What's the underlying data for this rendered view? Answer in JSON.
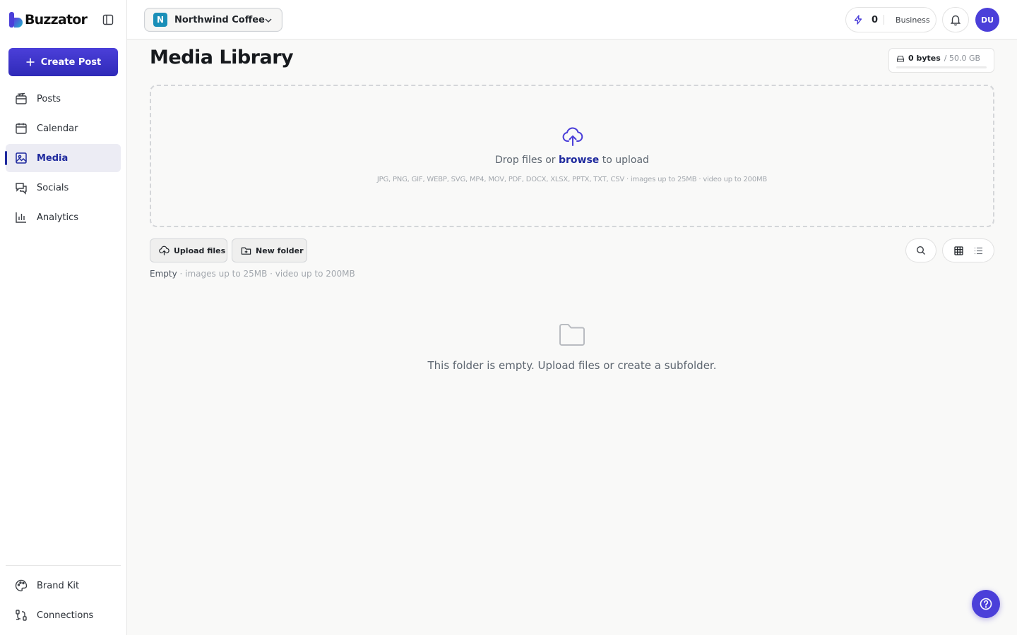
{
  "brand": {
    "name": "Buzzator",
    "accent": "#4b3fd9",
    "accent_dark": "#2f2ab8",
    "active_bg": "#ececf4",
    "active_text": "#1f2a9e"
  },
  "sidebar": {
    "create_label": "Create Post",
    "items": [
      {
        "label": "Posts",
        "icon": "posts-icon"
      },
      {
        "label": "Calendar",
        "icon": "calendar-icon"
      },
      {
        "label": "Media",
        "icon": "image-icon",
        "active": true
      },
      {
        "label": "Socials",
        "icon": "chat-icon"
      },
      {
        "label": "Analytics",
        "icon": "bar-chart-icon"
      }
    ],
    "bottom_items": [
      {
        "label": "Brand Kit",
        "icon": "palette-icon"
      },
      {
        "label": "Connections",
        "icon": "connections-icon"
      }
    ]
  },
  "topbar": {
    "workspace_initial": "N",
    "workspace_name": "Northwind Coffee",
    "workspace_color": "#1a8fb8",
    "credits": "0",
    "plan": "Business",
    "avatar_initials": "DU"
  },
  "main": {
    "title": "Media Library",
    "storage_used": "0 bytes",
    "storage_total": "/ 50.0 GB",
    "storage_fraction": 0,
    "dropzone": {
      "text_before": "Drop files or ",
      "browse": "browse",
      "text_after": " to upload",
      "formats": "JPG, PNG, GIF, WEBP, SVG, MP4, MOV, PDF, DOCX, XLSX, PPTX, TXT, CSV · images up to 25MB · video up to 200MB"
    },
    "upload_label": "Upload files",
    "new_folder_label": "New folder",
    "status_empty": "Empty",
    "status_limits": " · images up to 25MB · video up to 200MB",
    "empty_message": "This folder is empty. Upload files or create a subfolder."
  }
}
